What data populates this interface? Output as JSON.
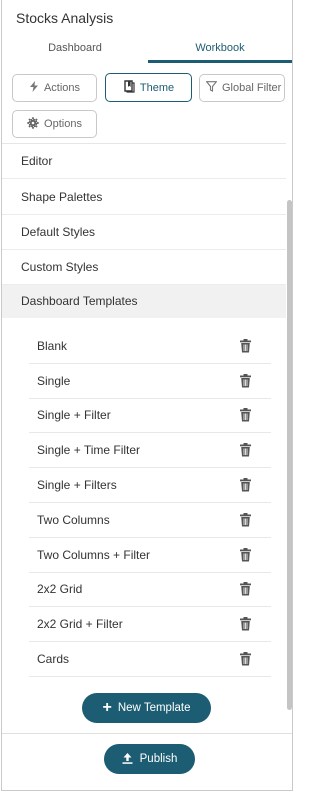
{
  "app": {
    "title": "Stocks Analysis"
  },
  "tabs": [
    {
      "label": "Dashboard",
      "active": false
    },
    {
      "label": "Workbook",
      "active": true
    }
  ],
  "toolbar": {
    "actions": "Actions",
    "theme": "Theme",
    "global_filter": "Global Filter",
    "options": "Options"
  },
  "sections": [
    {
      "label": "Editor"
    },
    {
      "label": "Shape Palettes"
    },
    {
      "label": "Default Styles"
    },
    {
      "label": "Custom Styles"
    },
    {
      "label": "Dashboard Templates",
      "active": true
    }
  ],
  "templates": [
    {
      "name": "Blank"
    },
    {
      "name": "Single"
    },
    {
      "name": "Single + Filter"
    },
    {
      "name": "Single + Time Filter"
    },
    {
      "name": "Single + Filters"
    },
    {
      "name": "Two Columns"
    },
    {
      "name": "Two Columns + Filter"
    },
    {
      "name": "2x2 Grid"
    },
    {
      "name": "2x2 Grid + Filter"
    },
    {
      "name": "Cards"
    }
  ],
  "buttons": {
    "new_template": "New Template",
    "publish": "Publish"
  },
  "colors": {
    "accent": "#1d5d73",
    "active_section_bg": "#f1f1f1"
  }
}
